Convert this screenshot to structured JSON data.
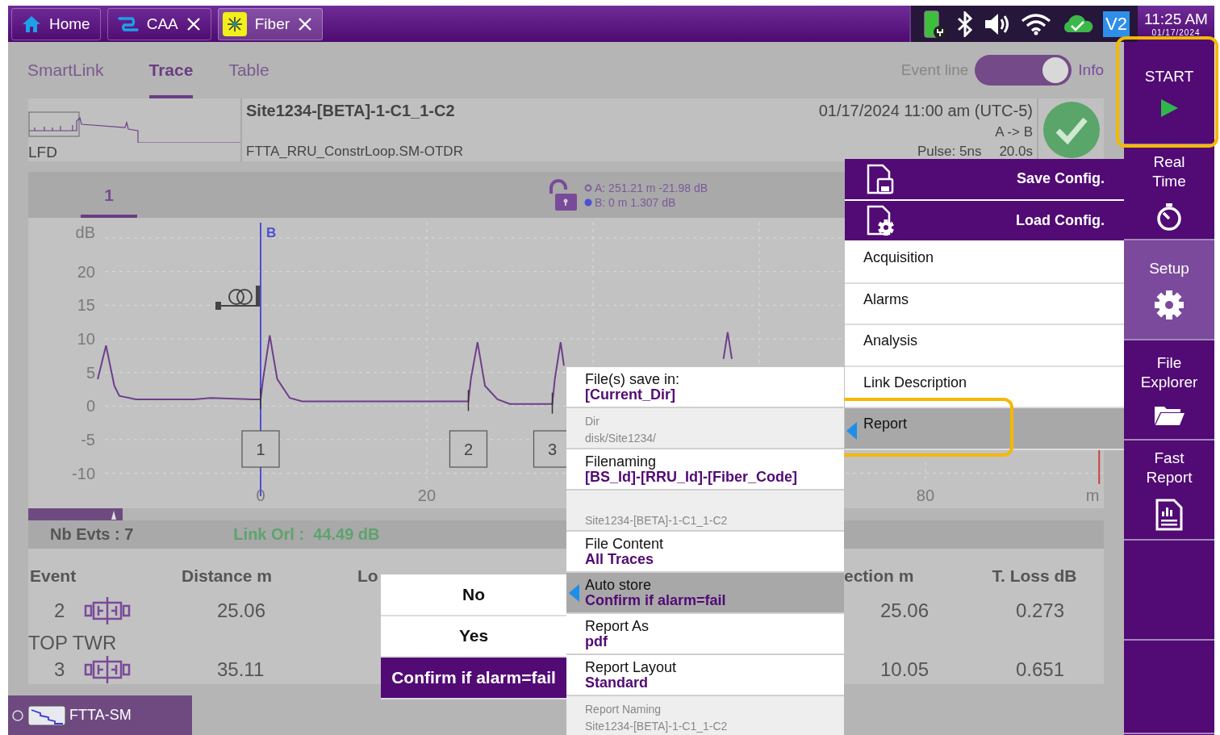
{
  "top_tabs": [
    {
      "label": "Home",
      "kind": "home",
      "closable": false,
      "selected": false
    },
    {
      "label": "CAA",
      "kind": "caa",
      "closable": true,
      "selected": false
    },
    {
      "label": "Fiber",
      "kind": "fiber",
      "closable": true,
      "selected": true
    }
  ],
  "status_bar": {
    "badge": "V2",
    "time": "11:25 AM",
    "date": "01/17/2024"
  },
  "view_tabs": [
    {
      "label": "SmartLink",
      "selected": false
    },
    {
      "label": "Trace",
      "selected": true
    },
    {
      "label": "Table",
      "selected": false
    }
  ],
  "event_toggle": {
    "off_label": "Event line",
    "on_label": "Info",
    "on": true
  },
  "result_header": {
    "title": "Site1234-[BETA]-1-C1_1-C2",
    "file": "FTTA_RRU_ConstrLoop.SM-OTDR",
    "datetime": "01/17/2024 11:00 am (UTC-5)",
    "direction": "A -> B",
    "pulse": "Pulse: 5ns",
    "duration": "20.0s",
    "thumbnail_label": "LFD"
  },
  "trace_panel": {
    "tabs": [
      {
        "label": "1",
        "selected": true
      }
    ],
    "locked": false,
    "cursor_a": "A: 251.21 m -21.98 dB",
    "cursor_b": "B: 0 m 1.307 dB",
    "chart_data": {
      "type": "line",
      "ylabel": "dB",
      "xlabel": "m",
      "grid": true,
      "xlim": [
        -27.96,
        101.46
      ],
      "ylim": [
        -15.22,
        28
      ],
      "xticks": [
        0,
        20,
        80
      ],
      "yticks": [
        -10,
        -5,
        0,
        5,
        10,
        15,
        20
      ],
      "x": [
        -19.6,
        -18.6,
        -17.6,
        -17,
        -15,
        -8,
        -6,
        -1,
        0,
        0.3,
        1.1,
        2,
        3.5,
        5,
        25,
        25.3,
        26.1,
        27,
        28.5,
        30,
        35.1,
        35.4,
        36.1,
        36.5,
        45,
        55.7,
        56.2,
        56.7
      ],
      "series": [
        {
          "color": "#6e3f8a",
          "values": [
            4,
            9,
            3,
            1.5,
            1,
            1,
            1.2,
            1,
            1,
            4,
            10.5,
            4,
            1.2,
            0.7,
            0.7,
            4,
            9.5,
            3,
            1,
            0.3,
            0.3,
            4,
            9.5,
            6,
            null,
            7,
            11,
            7
          ]
        }
      ],
      "ref_lines": [
        {
          "axis": "x",
          "value": 0,
          "label": "B",
          "color": "#4f4fd8"
        },
        {
          "axis": "x",
          "value": 100.9,
          "color": "#d04040"
        }
      ],
      "annotations": [
        {
          "x": 0,
          "y": 1,
          "text": "1"
        },
        {
          "x": 25,
          "y": 0.7,
          "text": "2"
        },
        {
          "x": 35.1,
          "y": 0.3,
          "text": "3"
        }
      ]
    }
  },
  "summary": {
    "events": "Nb Evts : 7",
    "link_orl": "Link Orl :  44.49 dB"
  },
  "events_table": {
    "columns": [
      "Event",
      "Distance  m",
      "Lo",
      "ection m",
      "T. Loss dB"
    ],
    "rows": [
      {
        "event": "2",
        "distance": "25.06",
        "section": "25.06",
        "total_loss": "0.273",
        "label": "TOP TWR"
      },
      {
        "event": "3",
        "distance": "35.11",
        "section": "10.05",
        "total_loss": "0.651"
      }
    ]
  },
  "footer_tab": {
    "label": "FTTA-SM",
    "selected": false
  },
  "sidebar": [
    {
      "kind": "start",
      "label": "START",
      "selected": false,
      "highlight": true
    },
    {
      "kind": "realtime",
      "label": "Real Time",
      "selected": false,
      "highlight": false
    },
    {
      "kind": "setup",
      "label": "Setup",
      "selected": true,
      "highlight": false
    },
    {
      "kind": "files",
      "label": "File Explorer",
      "selected": false,
      "highlight": false
    },
    {
      "kind": "report",
      "label": "Fast Report",
      "selected": false,
      "highlight": false
    },
    {
      "kind": "empty",
      "selected": false,
      "highlight": false
    },
    {
      "kind": "empty",
      "selected": false,
      "highlight": false
    }
  ],
  "setup_menu": [
    {
      "kind": "save",
      "label": "Save Config.",
      "selected": false,
      "highlight": false
    },
    {
      "kind": "load",
      "label": "Load Config.",
      "selected": false,
      "highlight": false
    },
    {
      "kind": "item",
      "label": "Acquisition",
      "selected": false,
      "highlight": false
    },
    {
      "kind": "item",
      "label": "Alarms",
      "selected": false,
      "highlight": false
    },
    {
      "kind": "item",
      "label": "Analysis",
      "selected": false,
      "highlight": false
    },
    {
      "kind": "item",
      "label": "Link Description",
      "selected": false,
      "highlight": false
    },
    {
      "kind": "item",
      "label": "Report",
      "selected": true,
      "highlight": true
    }
  ],
  "report_menu": [
    {
      "kind": "value",
      "label": "File(s) save in:",
      "value": "[Current_Dir]",
      "selected": false
    },
    {
      "kind": "info",
      "label": "Dir",
      "value": "disk/Site1234/",
      "selected": false
    },
    {
      "kind": "value",
      "label": "Filenaming",
      "value": "[BS_Id]-[RRU_Id]-[Fiber_Code]",
      "selected": false
    },
    {
      "kind": "info",
      "value": "Site1234-[BETA]-1-C1_1-C2",
      "selected": false
    },
    {
      "kind": "value",
      "label": "File Content",
      "value": "All Traces",
      "selected": false
    },
    {
      "kind": "value",
      "label": "Auto store",
      "value": "Confirm if alarm=fail",
      "selected": true
    },
    {
      "kind": "value",
      "label": "Report As",
      "value": "pdf",
      "selected": false
    },
    {
      "kind": "value",
      "label": "Report Layout",
      "value": "Standard",
      "selected": false
    },
    {
      "kind": "info",
      "label": "Report Naming",
      "value": "Site1234-[BETA]-1-C1_1-C2",
      "selected": false
    }
  ],
  "choice_popup": [
    {
      "label": "No",
      "selected": false
    },
    {
      "label": "Yes",
      "selected": false
    },
    {
      "label": "Confirm if alarm=fail",
      "selected": true
    }
  ]
}
